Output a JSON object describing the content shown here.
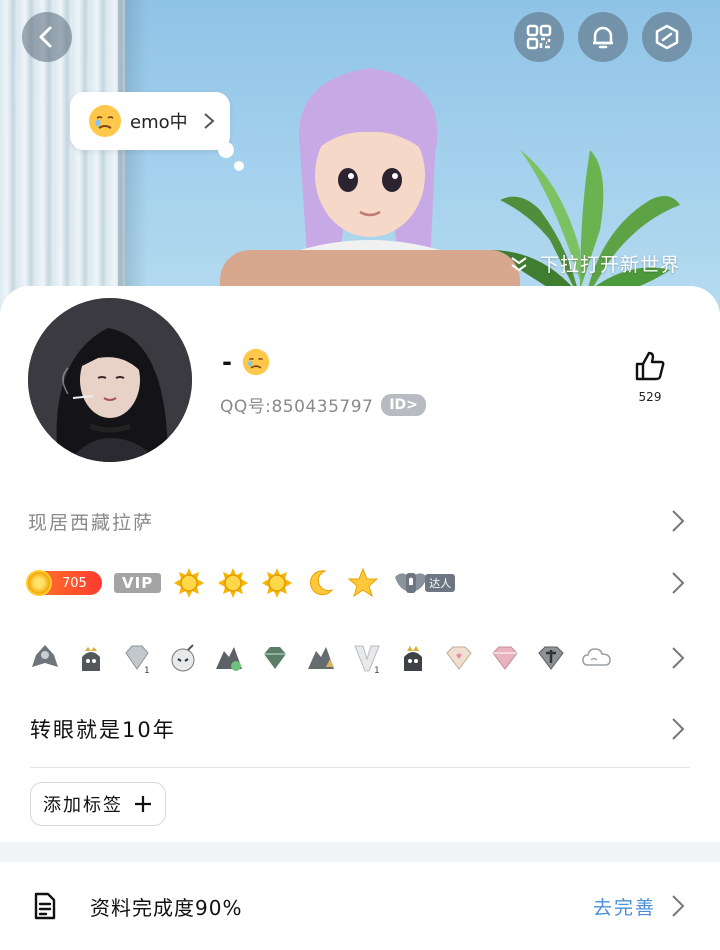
{
  "header": {
    "status": {
      "text": "emo中",
      "emoji_icon": "sad-face-icon"
    },
    "pull_hint": "下拉打开新世界",
    "buttons": [
      "back-icon",
      "qr-code-icon",
      "bell-icon",
      "hexagon-settings-icon"
    ]
  },
  "profile": {
    "nickname": "-",
    "qq_number": "QQ号:850435797",
    "id_badge": "ID>",
    "likes": "529"
  },
  "location": {
    "text": "现居西藏拉萨"
  },
  "badges": {
    "level": "705",
    "vip": "VIP",
    "talent": "达人",
    "icons": [
      "sun-icon",
      "sun-icon",
      "sun-icon",
      "moon-icon",
      "star-icon",
      "wings-icon"
    ]
  },
  "medals": [
    "bird-medal",
    "crown-medal",
    "diamond-medal",
    "bomb-medal",
    "mountain-medal",
    "gem-medal",
    "mountain-medal",
    "v-medal",
    "crown-medal",
    "heart-diamond-medal",
    "pink-diamond-medal",
    "dark-diamond-medal",
    "cloud-medal"
  ],
  "signature": {
    "text": "转眼就是10年"
  },
  "tags": {
    "add_label": "添加标签"
  },
  "completion": {
    "text": "资料完成度90%",
    "action": "去完善"
  },
  "colors": {
    "accent_blue": "#4a8fd8",
    "level_orange": "#ff5a2a",
    "sky": "#9ccbe9"
  }
}
